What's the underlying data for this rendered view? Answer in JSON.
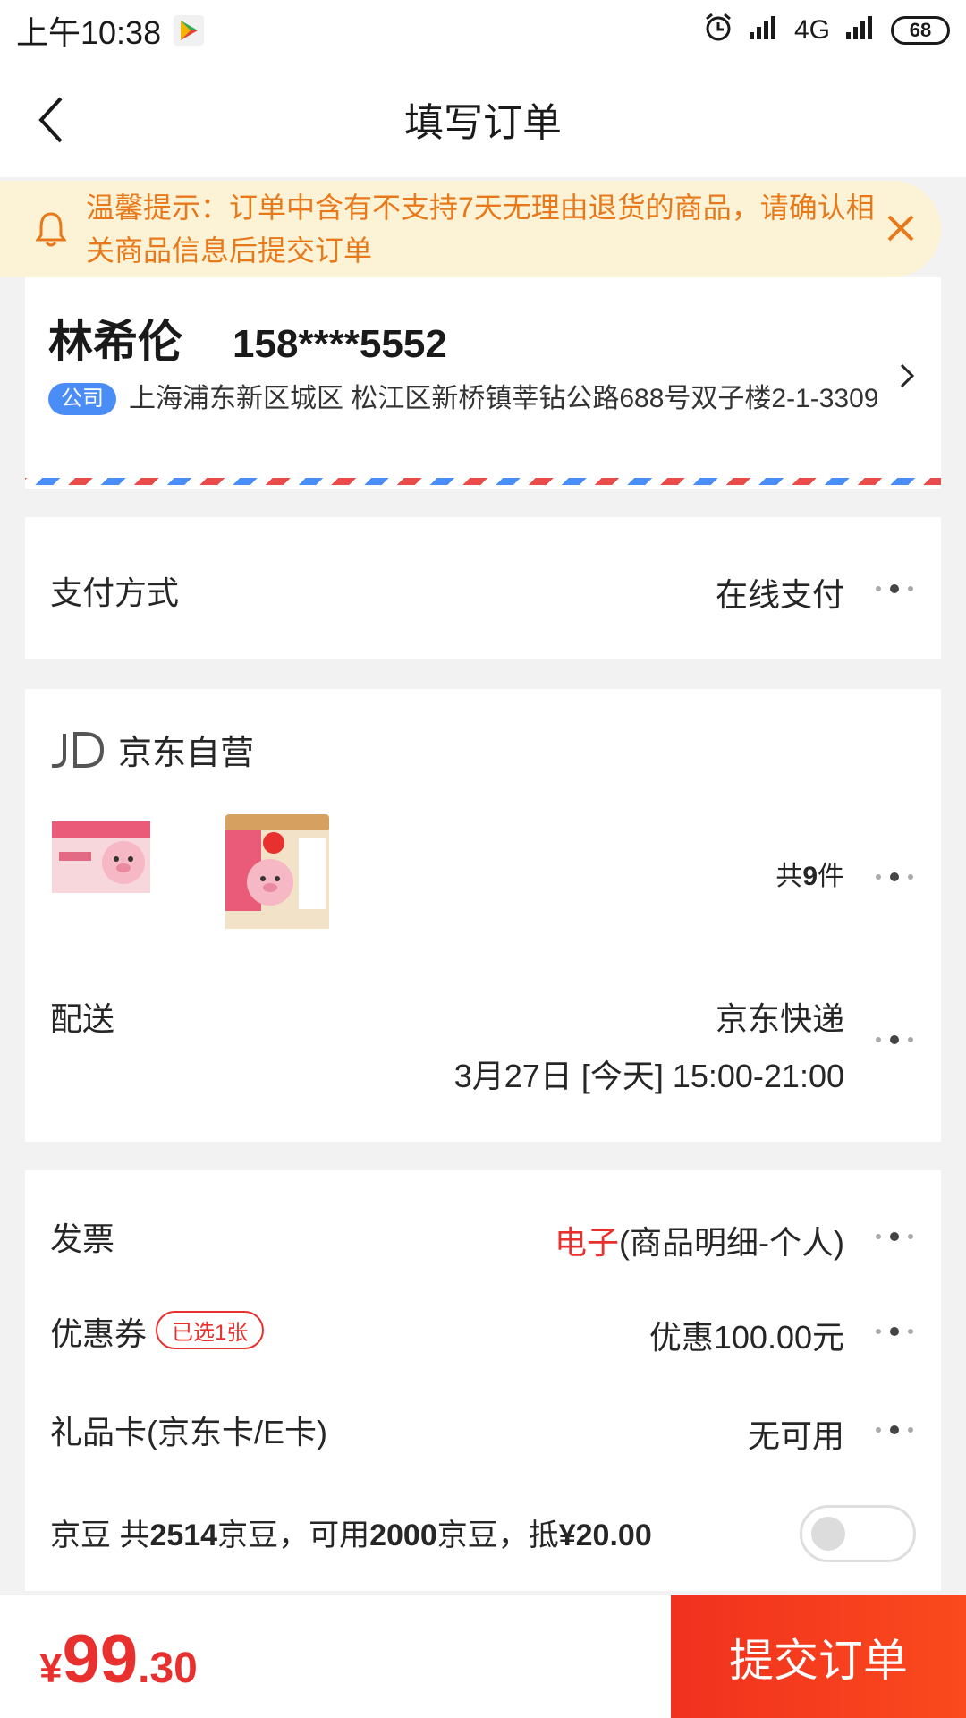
{
  "status_bar": {
    "time": "上午10:38",
    "network": "4G",
    "battery": "68"
  },
  "header": {
    "title": "填写订单"
  },
  "notice": {
    "text": "温馨提示：订单中含有不支持7天无理由退货的商品，请确认相关商品信息后提交订单"
  },
  "address": {
    "name": "林希伦",
    "phone": "158****5552",
    "tag": "公司",
    "detail": "上海浦东新区城区 松江区新桥镇莘钻公路688号双子楼2-1-3309"
  },
  "payment": {
    "label": "支付方式",
    "value": "在线支付"
  },
  "store": {
    "name": "京东自营",
    "count_prefix": "共",
    "count": "9",
    "count_suffix": "件"
  },
  "delivery": {
    "label": "配送",
    "carrier": "京东快递",
    "time": "3月27日 [今天] 15:00-21:00"
  },
  "invoice": {
    "label": "发票",
    "type_highlight": "电子",
    "detail": "(商品明细-个人)"
  },
  "coupon": {
    "label": "优惠券",
    "tag": "已选1张",
    "value": "优惠100.00元"
  },
  "gift_card": {
    "label": "礼品卡(京东卡/E卡)",
    "value": "无可用"
  },
  "jingdou": {
    "label": "京豆",
    "part1": " 共",
    "total": "2514",
    "part2": "京豆，可用",
    "available": "2000",
    "part3": "京豆，抵",
    "deduct": "¥20.00",
    "enabled": false
  },
  "footer": {
    "currency": "¥",
    "price_int": "99",
    "price_dec": ".30",
    "submit_label": "提交订单"
  },
  "colors": {
    "accent_red": "#e8302e",
    "notice_orange": "#e8791b",
    "notice_bg": "#fcf3d6",
    "tag_blue": "#4a8df6"
  }
}
